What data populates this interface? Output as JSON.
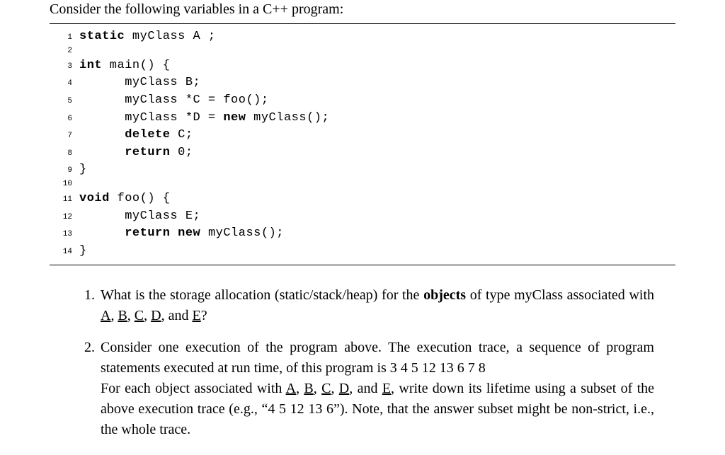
{
  "intro": "Consider the following variables in a C++ program:",
  "code": {
    "lines": [
      {
        "n": "1",
        "kw1": "static",
        "rest": " myClass A ;"
      },
      {
        "n": "2",
        "rest": ""
      },
      {
        "n": "3",
        "kw1": "int",
        "rest": " main() {"
      },
      {
        "n": "4",
        "indent": "      ",
        "rest": "myClass B;"
      },
      {
        "n": "5",
        "indent": "      ",
        "rest": "myClass *C = foo();"
      },
      {
        "n": "6",
        "indent": "      ",
        "rest": "myClass *D = ",
        "kw2": "new",
        "rest2": " myClass();"
      },
      {
        "n": "7",
        "indent": "      ",
        "kw1": "delete",
        "rest": " C;"
      },
      {
        "n": "8",
        "indent": "      ",
        "kw1": "return",
        "rest": " 0;"
      },
      {
        "n": "9",
        "rest": "}"
      },
      {
        "n": "10",
        "rest": ""
      },
      {
        "n": "11",
        "kw1": "void",
        "rest": " foo() {"
      },
      {
        "n": "12",
        "indent": "      ",
        "rest": "myClass E;"
      },
      {
        "n": "13",
        "indent": "      ",
        "kw1": "return",
        "rest": " ",
        "kw2": "new",
        "rest2": " myClass();"
      },
      {
        "n": "14",
        "rest": "}"
      }
    ]
  },
  "q1": {
    "num": "1.",
    "p1": "What is the storage allocation (static/stack/heap) for the ",
    "bold": "objects",
    "p2": " of type myClass associated with ",
    "A": "A",
    "c1": ", ",
    "B": "B",
    "c2": ", ",
    "C": "C",
    "c3": ", ",
    "D": "D",
    "c4": ", and ",
    "E": "E",
    "tail": "?"
  },
  "q2": {
    "num": "2.",
    "p1": "Consider one execution of the program above.  The execution trace, a sequence of program statements executed at run time, of this program is 3 4 5 12 13 6 7 8",
    "p2a": "For each object associated with ",
    "A": "A",
    "c1": ", ",
    "B": "B",
    "c2": ", ",
    "C": "C",
    "c3": ", ",
    "D": "D",
    "c4": ", and ",
    "E": "E",
    "p2b": ", write down its lifetime using a subset of the above execution trace (e.g., “4 5 12 13 6”). Note, that the answer subset might be non-strict, i.e., the whole trace."
  }
}
